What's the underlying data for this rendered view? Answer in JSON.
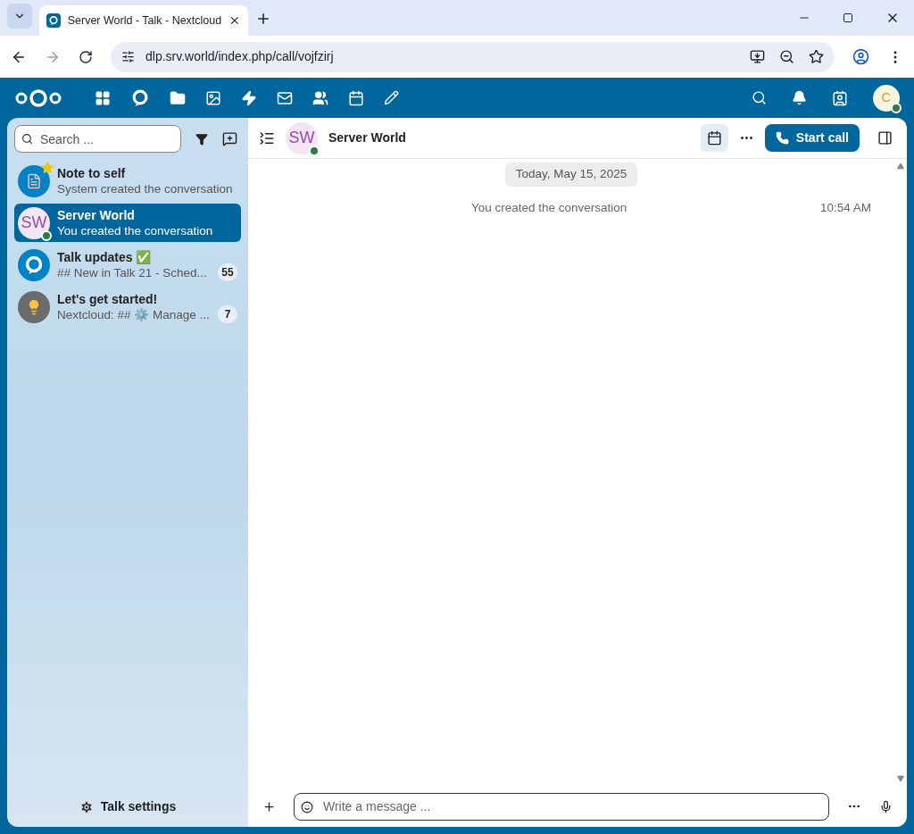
{
  "browser": {
    "tab_title": "Server World - Talk - Nextcloud",
    "url": "dlp.srv.world/index.php/call/vojfzirj"
  },
  "header": {
    "user_initial": "C",
    "user_online": true
  },
  "sidebar": {
    "search_placeholder": "Search ...",
    "conversations": [
      {
        "kind": "note",
        "name": "Note to self",
        "preview": "System created the conversation",
        "favorite": true,
        "online": false,
        "selected": false
      },
      {
        "kind": "initials",
        "initials": "SW",
        "name": "Server World",
        "preview": "You created the conversation",
        "favorite": false,
        "online": true,
        "selected": true
      },
      {
        "kind": "talk",
        "name": "Talk updates ✅",
        "preview": "## New in Talk 21 - Sched...",
        "unread": "55",
        "favorite": false,
        "online": false,
        "selected": false
      },
      {
        "kind": "bulb",
        "name": "Let's get started!",
        "preview": "Nextcloud: ## ⚙️ Manage ...",
        "unread": "7",
        "favorite": false,
        "online": false,
        "selected": false
      }
    ],
    "settings_label": "Talk settings"
  },
  "chat": {
    "initials": "SW",
    "title": "Server World",
    "online": true,
    "start_call": "Start call",
    "date_separator": "Today, May 15, 2025",
    "messages": [
      {
        "text": "You created the conversation",
        "time": "10:54 AM"
      }
    ],
    "composer_placeholder": "Write a message ..."
  }
}
